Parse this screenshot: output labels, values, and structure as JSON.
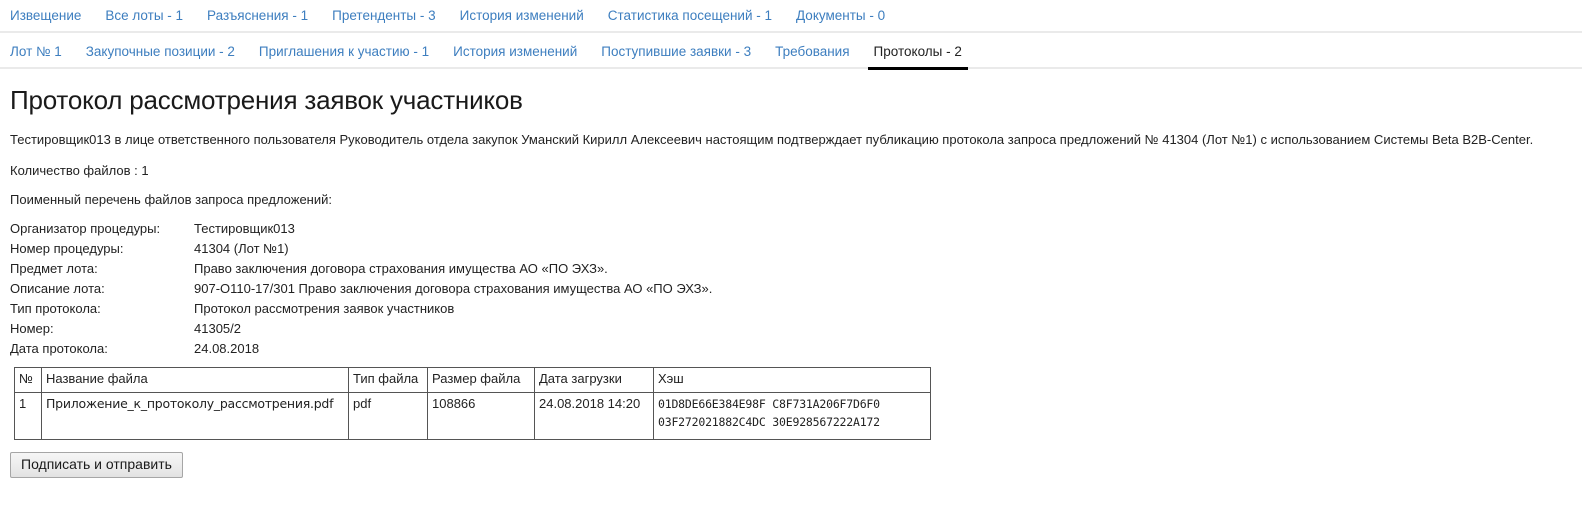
{
  "nav_primary": {
    "items": [
      {
        "label": "Извещение",
        "active": false
      },
      {
        "label": "Все лоты - 1",
        "active": false
      },
      {
        "label": "Разъяснения - 1",
        "active": false
      },
      {
        "label": "Претенденты - 3",
        "active": false
      },
      {
        "label": "История изменений",
        "active": false
      },
      {
        "label": "Статистика посещений - 1",
        "active": false
      },
      {
        "label": "Документы - 0",
        "active": false
      }
    ]
  },
  "nav_secondary": {
    "items": [
      {
        "label": "Лот № 1",
        "active": false
      },
      {
        "label": "Закупочные позиции - 2",
        "active": false
      },
      {
        "label": "Приглашения к участию - 1",
        "active": false
      },
      {
        "label": "История изменений",
        "active": false
      },
      {
        "label": "Поступившие заявки - 3",
        "active": false
      },
      {
        "label": "Требования",
        "active": false
      },
      {
        "label": "Протоколы - 2",
        "active": true
      }
    ]
  },
  "page": {
    "title": "Протокол рассмотрения заявок участников",
    "intro": "Тестировщик013 в лице ответственного пользователя Руководитель отдела закупок Уманский Кирилл Алексеевич настоящим подтверждает публикацию протокола запроса предложений № 41304 (Лот №1) с использованием Системы Beta B2B-Center.",
    "files_count_line": "Количество файлов : 1",
    "files_list_heading": "Поименный перечень файлов запроса предложений:"
  },
  "fields": [
    {
      "label": "Организатор процедуры:",
      "value": "Тестировщик013",
      "inline": true
    },
    {
      "label": "Номер процедуры:",
      "value": "41304 (Лот №1)",
      "inline": false
    },
    {
      "label": "Предмет лота:",
      "value": "Право заключения договора страхования имущества АО «ПО ЭХЗ».",
      "inline": false
    },
    {
      "label": "Описание лота:",
      "value": "907-О110-17/301 Право заключения договора страхования имущества АО «ПО ЭХЗ».",
      "inline": false
    },
    {
      "label": "Тип протокола:",
      "value": "Протокол рассмотрения заявок участников",
      "inline": false
    },
    {
      "label": "Номер:",
      "value": "41305/2",
      "inline": false
    },
    {
      "label": "Дата протокола:",
      "value": "24.08.2018",
      "inline": false
    }
  ],
  "files_table": {
    "columns": [
      "№",
      "Название файла",
      "Тип файла",
      "Размер файла",
      "Дата загрузки",
      "Хэш"
    ],
    "rows": [
      {
        "num": "1",
        "name": "Приложение_к_протоколу_рассмотрения.pdf",
        "type": "pdf",
        "size": "108866",
        "date": "24.08.2018 14:20",
        "hash": "01D8DE66E384E98F C8F731A206F7D6F0\n03F272021882C4DC 30E928567222A172"
      }
    ]
  },
  "actions": {
    "submit_label": "Подписать и отправить"
  },
  "colors": {
    "link": "#3d7ebf",
    "active_tab_text": "#222222",
    "active_tab_underline": "#000000",
    "separator": "#eaeaea",
    "table_border": "#555555",
    "text": "#222222"
  }
}
